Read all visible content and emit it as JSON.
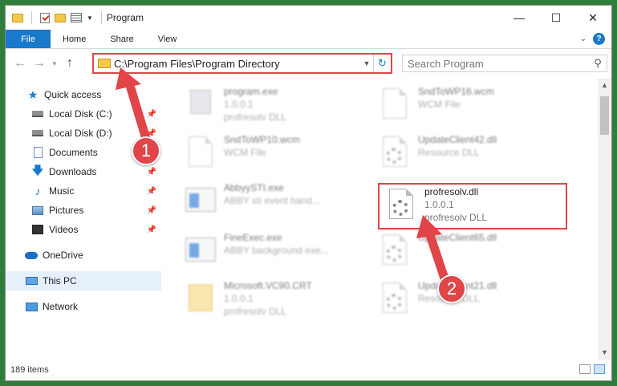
{
  "window": {
    "title": "Program",
    "controls": [
      "minimize-icon",
      "maximize-icon",
      "close-icon"
    ]
  },
  "ribbon": {
    "tabs": [
      "File",
      "Home",
      "Share",
      "View"
    ],
    "help": "?"
  },
  "address": {
    "path": "C:\\Program Files\\Program Directory"
  },
  "search": {
    "placeholder": "Search Program"
  },
  "sidebar": {
    "quick_access": "Quick access",
    "items": [
      {
        "label": "Local Disk (C:)",
        "icon": "local-disk-icon",
        "pinned": true
      },
      {
        "label": "Local Disk (D:)",
        "icon": "local-disk-icon",
        "pinned": true
      },
      {
        "label": "Documents",
        "icon": "documents-icon",
        "pinned": true
      },
      {
        "label": "Downloads",
        "icon": "downloads-icon",
        "pinned": true
      },
      {
        "label": "Music",
        "icon": "music-icon",
        "pinned": true
      },
      {
        "label": "Pictures",
        "icon": "pictures-icon",
        "pinned": true
      },
      {
        "label": "Videos",
        "icon": "videos-icon",
        "pinned": true
      }
    ],
    "onedrive": "OneDrive",
    "this_pc": "This PC",
    "network": "Network"
  },
  "files": [
    {
      "name": "program.exe",
      "line2": "1.0.0.1",
      "line3": "profresolv DLL",
      "icon": "exe"
    },
    {
      "name": "SndToWP16.wcm",
      "line2": "WCM File",
      "line3": "",
      "icon": "page"
    },
    {
      "name": "SndToWP10.wcm",
      "line2": "WCM File",
      "line3": "",
      "icon": "page"
    },
    {
      "name": "UpdateClient42.dll",
      "line2": "Resource DLL",
      "line3": "",
      "icon": "dll"
    },
    {
      "name": "AbbyySTI.exe",
      "line2": "ABBY sti event hand...",
      "line3": "",
      "icon": "win"
    },
    {
      "name": "profresolv.dll",
      "line2": "1.0.0.1",
      "line3": "profresolv DLL",
      "icon": "dll"
    },
    {
      "name": "FineExec.exe",
      "line2": "ABBY background exe...",
      "line3": "",
      "icon": "win"
    },
    {
      "name": "UpdateClient65.dll",
      "line2": "",
      "line3": "",
      "icon": "dll"
    },
    {
      "name": "Microsoft.VC90.CRT",
      "line2": "1.0.0.1",
      "line3": "profresolv DLL",
      "icon": "folder"
    },
    {
      "name": "UpdateClient21.dll",
      "line2": "Resource DLL",
      "line3": "",
      "icon": "dll"
    }
  ],
  "annotations": {
    "step1": "1",
    "step2": "2",
    "color": "#e04548"
  },
  "status": {
    "items_count": "189 items"
  }
}
